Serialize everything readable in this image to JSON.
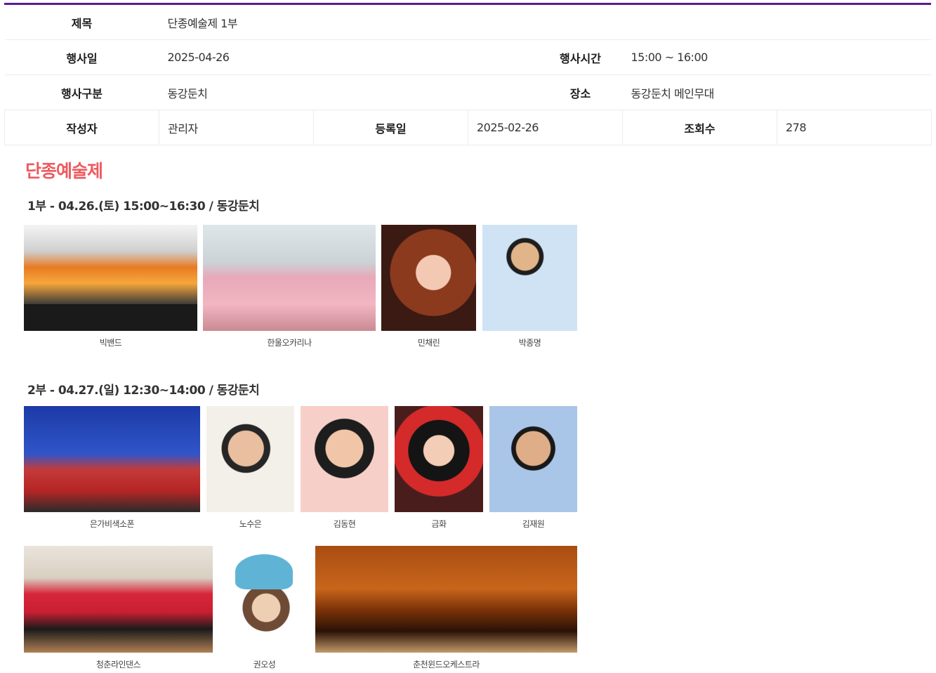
{
  "info": {
    "row1": {
      "title_label": "제목",
      "title_value": "단종예술제 1부"
    },
    "row2": {
      "date_label": "행사일",
      "date_value": "2025-04-26",
      "time_label": "행사시간",
      "time_value": "15:00 ~ 16:00"
    },
    "row3": {
      "category_label": "행사구분",
      "category_value": "동강둔치",
      "place_label": "장소",
      "place_value": "동강둔치 메인무대"
    },
    "row4": {
      "author_label": "작성자",
      "author_value": "관리자",
      "reg_label": "등록일",
      "reg_value": "2025-02-26",
      "views_label": "조회수",
      "views_value": "278"
    }
  },
  "content": {
    "heading": "단종예술제",
    "part1": {
      "title": "1부 - 04.26.(토) 15:00~16:30 / 동강둔치",
      "performers": [
        "빅밴드",
        "한울오카리나",
        "민채린",
        "박종명"
      ]
    },
    "part2": {
      "title": "2부 - 04.27.(일) 12:30~14:00 / 동강둔치",
      "performers_row1": [
        "은가비색소폰",
        "노수은",
        "김동현",
        "금화",
        "김재원"
      ],
      "performers_row2": [
        "청춘라인댄스",
        "권오성",
        "춘천윈드오케스트라"
      ]
    }
  },
  "colors": {
    "accent_bar": "#5b1a96",
    "heading": "#ee5a5f"
  }
}
